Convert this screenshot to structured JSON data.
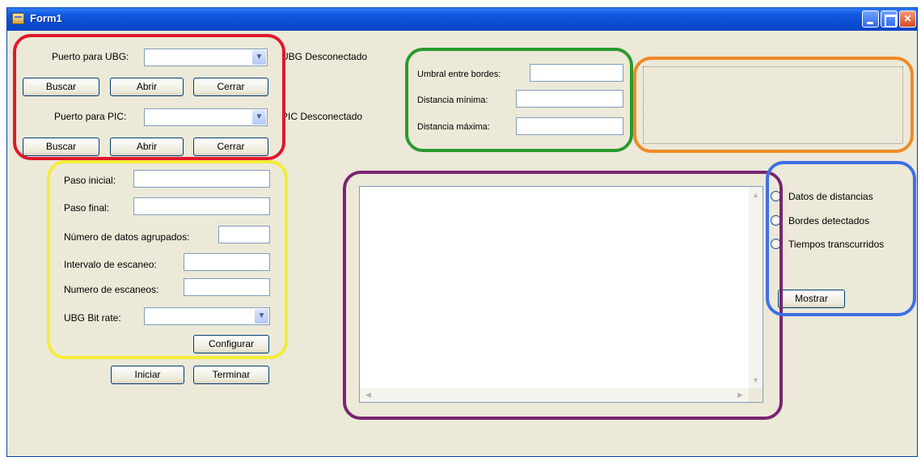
{
  "window": {
    "title": "Form1"
  },
  "serial": {
    "ubg_port_label": "Puerto para UBG:",
    "ubg_port_value": "",
    "ubg_status": "UBG Desconectado",
    "pic_port_label": "Puerto para PIC:",
    "pic_port_value": "",
    "pic_status": "PIC Desconectado",
    "search_label": "Buscar",
    "open_label": "Abrir",
    "close_label": "Cerrar"
  },
  "thresholds": {
    "edge_threshold_label": "Umbral entre bordes:",
    "min_distance_label": "Distancia mínima:",
    "max_distance_label": "Distancia máxima:"
  },
  "config": {
    "start_step_label": "Paso inicial:",
    "end_step_label": "Paso final:",
    "grouped_count_label": "Número de datos agrupados:",
    "scan_interval_label": "Intervalo de escaneo:",
    "scan_count_label": "Numero de escaneos:",
    "bitrate_label": "UBG Bit rate:",
    "bitrate_value": "",
    "configure_label": "Configurar",
    "start_label": "Iniciar",
    "stop_label": "Terminar"
  },
  "output": {
    "radio_distances": "Datos de distancias",
    "radio_edges": "Bordes detectados",
    "radio_times": "Tiempos transcurridos",
    "show_label": "Mostrar"
  },
  "colors": {
    "red": "#e0182c",
    "green": "#2a9a2e",
    "orange": "#f08a24",
    "yellow": "#f3ec3a",
    "purple": "#7a2473",
    "blue": "#3f6fe6"
  }
}
